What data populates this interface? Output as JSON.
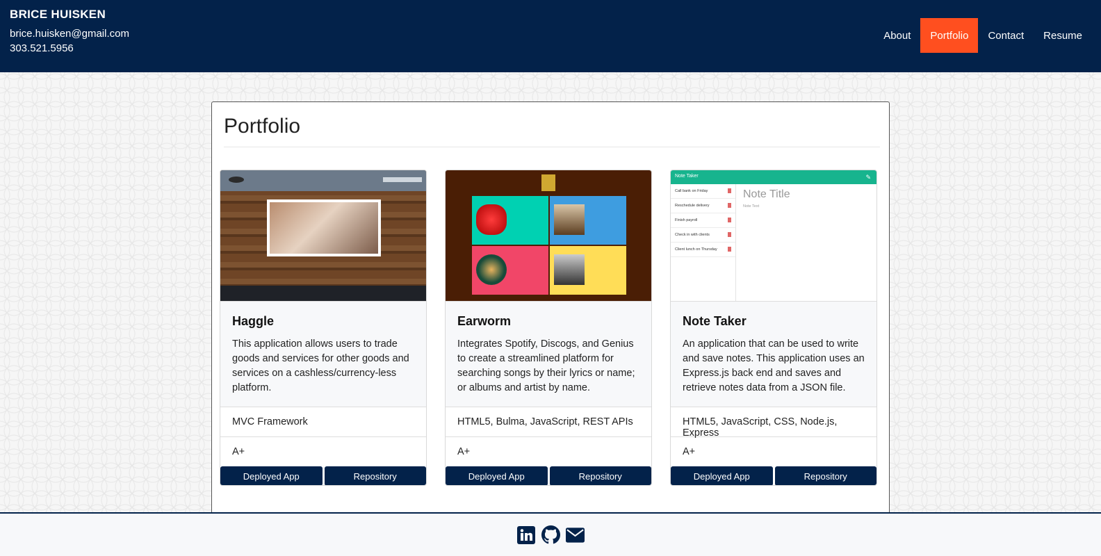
{
  "header": {
    "name": "BRICE HUISKEN",
    "email": "brice.huisken@gmail.com",
    "phone": "303.521.5956",
    "nav": [
      {
        "label": "About",
        "active": false
      },
      {
        "label": "Portfolio",
        "active": true
      },
      {
        "label": "Contact",
        "active": false
      },
      {
        "label": "Resume",
        "active": false
      }
    ]
  },
  "main": {
    "title": "Portfolio",
    "cards": [
      {
        "title": "Haggle",
        "description": "This application allows users to trade goods and services for other goods and services on a cashless/currency-less platform.",
        "tech": "MVC Framework",
        "grade": "A+",
        "deploy_label": "Deployed App",
        "repo_label": "Repository"
      },
      {
        "title": "Earworm",
        "description": "Integrates Spotify, Discogs, and Genius to create a streamlined platform for searching songs by their lyrics or name; or albums and artist by name.",
        "tech": "HTML5, Bulma, JavaScript, REST APIs",
        "grade": "A+",
        "deploy_label": "Deployed App",
        "repo_label": "Repository"
      },
      {
        "title": "Note Taker",
        "description": "An application that can be used to write and save notes. This application uses an Express.js back end and saves and retrieve notes data from a JSON file.",
        "tech": "HTML5, JavaScript, CSS, Node.js, Express",
        "grade": "A+",
        "deploy_label": "Deployed App",
        "repo_label": "Repository",
        "screenshot": {
          "app_title": "Note Taker",
          "notes": [
            "Call bank on Friday",
            "Reschedule delivery",
            "Finish payroll",
            "Check in with clients",
            "Client lunch on Thursday"
          ],
          "note_title_placeholder": "Note Title",
          "note_text_placeholder": "Note Text"
        }
      }
    ]
  },
  "footer": {
    "icons": [
      "linkedin-icon",
      "github-icon",
      "email-icon"
    ]
  },
  "colors": {
    "navy": "#03224a",
    "accent": "#ff4f1f"
  }
}
